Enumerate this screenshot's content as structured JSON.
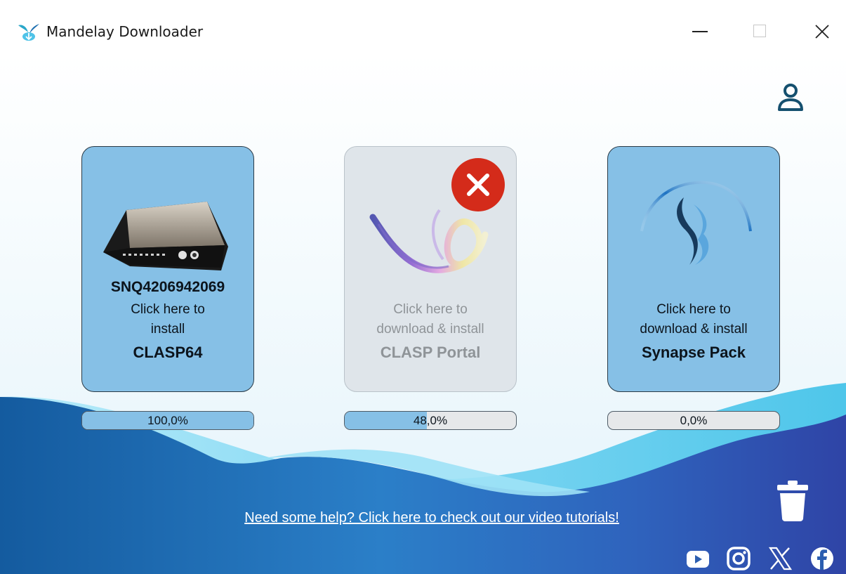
{
  "window": {
    "title": "Mandelay Downloader",
    "controls": [
      "minimize",
      "maximize",
      "close"
    ]
  },
  "header": {
    "user_icon": "user-icon"
  },
  "cards": [
    {
      "serial": "SNQ4206942069",
      "line1": "Click here to",
      "line2": "install",
      "name": "CLASP64",
      "state": "active",
      "image": "device-image",
      "progress": {
        "value": 1.0,
        "label": "100,0%"
      }
    },
    {
      "line1": "Click here to",
      "line2": "download & install",
      "name": "CLASP Portal",
      "state": "disabled",
      "image": "clasp-portal-logo",
      "badge": "error-icon",
      "progress": {
        "value": 0.48,
        "label": "48,0%"
      }
    },
    {
      "line1": "Click here to",
      "line2": "download & install",
      "name": "Synapse Pack",
      "state": "active",
      "image": "synapse-logo",
      "progress": {
        "value": 0.0,
        "label": "0,0%"
      }
    }
  ],
  "footer": {
    "help_link": "Need some help? Click here to check out our video tutorials!",
    "trash_icon": "trash-icon",
    "social": [
      "youtube-icon",
      "instagram-icon",
      "x-icon",
      "facebook-icon"
    ]
  },
  "colors": {
    "card_active": "#86c0e6",
    "card_disabled": "#dfe5ea",
    "error_badge": "#d42b1a",
    "wave_dark": "#1e63a8",
    "wave_light": "#8fdcf4"
  }
}
